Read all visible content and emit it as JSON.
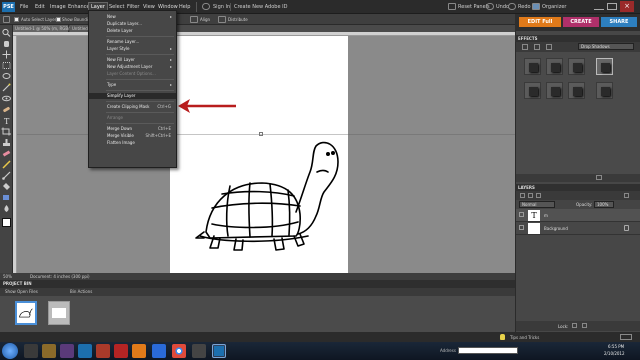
{
  "app": {
    "logo": "PSE",
    "menus": [
      "File",
      "Edit",
      "Image",
      "Enhance",
      "Layer",
      "Select",
      "Filter",
      "View",
      "Window",
      "Help"
    ],
    "toolbar": {
      "sign_in": "Sign In",
      "create_id": "Create New Adobe ID",
      "reset_panels": "Reset Panels",
      "undo": "Undo",
      "redo": "Redo",
      "organizer": "Organizer"
    }
  },
  "options_bar": {
    "auto_select": "Auto Select Layer",
    "show_bounding": "Show Bounding",
    "align": "Align",
    "distribute": "Distribute"
  },
  "doc_tabs": [
    "Untitled-1 @ 50% (m, RGB/8) *",
    "Untitled"
  ],
  "layer_menu": {
    "items": [
      {
        "label": "New",
        "arrow": "▸",
        "disabled": false
      },
      {
        "label": "Duplicate Layer...",
        "disabled": false
      },
      {
        "label": "Delete Layer",
        "disabled": false
      },
      {
        "sep": true
      },
      {
        "label": "Rename Layer...",
        "disabled": false
      },
      {
        "label": "Layer Style",
        "arrow": "▸",
        "disabled": false
      },
      {
        "sep": true
      },
      {
        "label": "New Fill Layer",
        "arrow": "▸",
        "disabled": false
      },
      {
        "label": "New Adjustment Layer",
        "arrow": "▸",
        "disabled": false
      },
      {
        "label": "Layer Content Options...",
        "disabled": true
      },
      {
        "sep": true
      },
      {
        "label": "Type",
        "arrow": "▸",
        "disabled": false
      },
      {
        "sep": true
      },
      {
        "label": "Simplify Layer",
        "disabled": false,
        "highlight": true
      },
      {
        "sep": true
      },
      {
        "label": "Create Clipping Mask",
        "shortcut": "Ctrl+G",
        "disabled": false
      },
      {
        "sep": true
      },
      {
        "label": "Arrange",
        "disabled": true
      },
      {
        "sep": true
      },
      {
        "label": "Merge Down",
        "shortcut": "Ctrl+E",
        "disabled": false
      },
      {
        "label": "Merge Visible",
        "shortcut": "Shift+Ctrl+E",
        "disabled": false
      },
      {
        "label": "Flatten Image",
        "disabled": false
      }
    ]
  },
  "status": {
    "zoom": "50%",
    "doc_info": "Document: 4 inches (300 ppi)"
  },
  "project_bin": {
    "title": "PROJECT BIN",
    "show": "Show Open Files",
    "bin_actions": "Bin Actions"
  },
  "mode_buttons": {
    "edit": "EDIT Full",
    "create": "CREATE",
    "share": "SHARE",
    "colors": {
      "edit": "#e07a1a",
      "create": "#b0306a",
      "share": "#2d7fbf"
    }
  },
  "effects_panel": {
    "title": "EFFECTS",
    "category": "Drop Shadows"
  },
  "layers_panel": {
    "title": "LAYERS",
    "blend_mode": "Normal",
    "opacity_label": "Opacity:",
    "opacity_value": "100%",
    "lock_label": "Lock:",
    "layers": [
      {
        "name": "m",
        "type": "text"
      },
      {
        "name": "Background",
        "type": "bg"
      }
    ]
  },
  "tips": {
    "label": "Tips and Tricks"
  },
  "taskbar": {
    "address_label": "Address",
    "time": "6:55 PM",
    "date": "2/10/2012"
  }
}
